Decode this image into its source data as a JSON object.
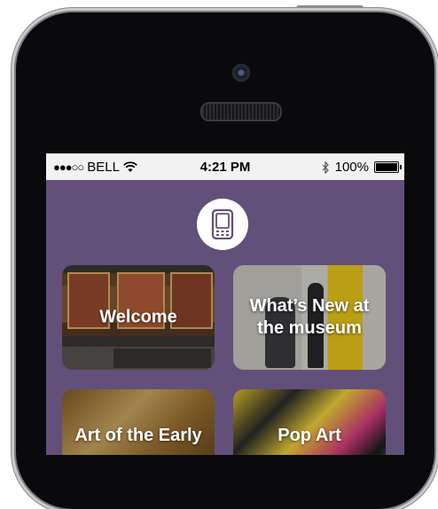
{
  "status_bar": {
    "signal": "●●●○○",
    "carrier": "BELL",
    "time": "4:21 PM",
    "battery_percent": "100%"
  },
  "colors": {
    "screen_background": "#62507a",
    "status_bar_background": "#f2f2f2"
  },
  "tiles": [
    {
      "label": "Welcome"
    },
    {
      "label": "What’s New at the museum"
    },
    {
      "label": "Art of the Early"
    },
    {
      "label": "Pop Art"
    }
  ]
}
